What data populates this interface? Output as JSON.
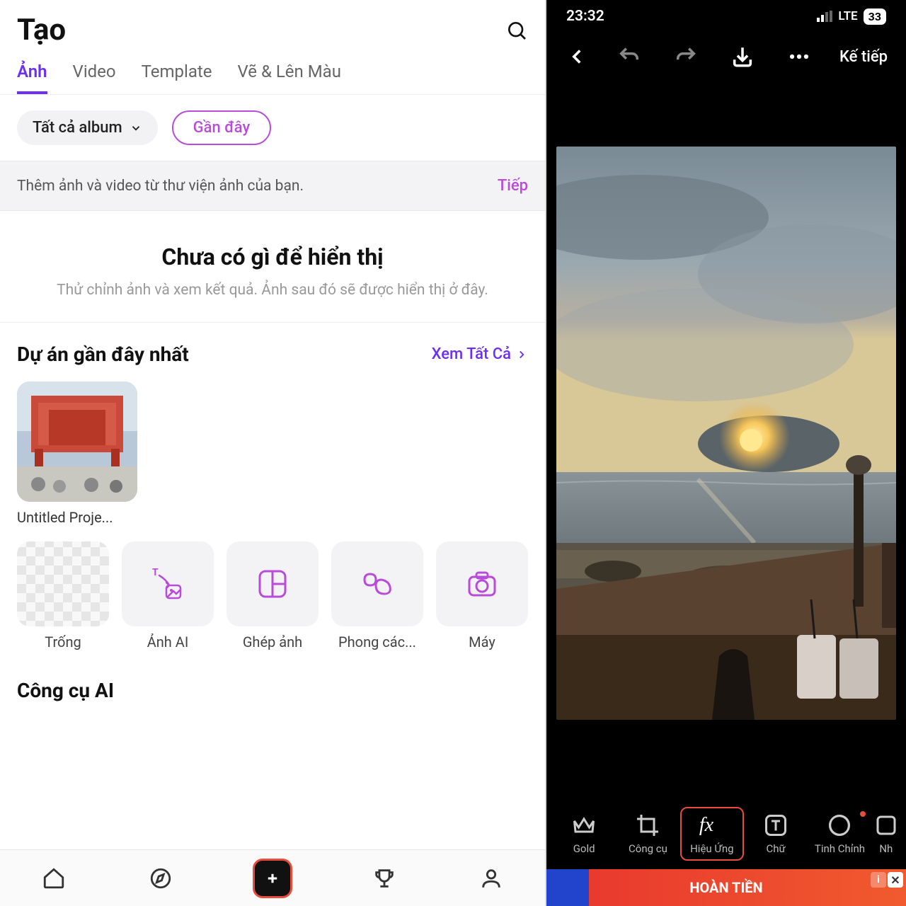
{
  "left": {
    "title": "Tạo",
    "tabs": [
      "Ảnh",
      "Video",
      "Template",
      "Vẽ & Lên Màu"
    ],
    "albumDrop": "Tất cả album",
    "recentChip": "Gần đây",
    "noticeText": "Thêm ảnh và video từ thư viện ảnh của bạn.",
    "noticeAction": "Tiếp",
    "emptyTitle": "Chưa có gì để hiển thị",
    "emptySub": "Thử chỉnh ảnh và xem kết quả. Ảnh sau đó sẽ được hiển thị ở đây.",
    "recentHead": "Dự án gần đây nhất",
    "viewAll": "Xem Tất Cả",
    "project": {
      "name": "Untitled Proje..."
    },
    "tools": [
      {
        "label": "Trống",
        "icon": "blank"
      },
      {
        "label": "Ảnh AI",
        "icon": "ai"
      },
      {
        "label": "Ghép ảnh",
        "icon": "collage"
      },
      {
        "label": "Phong các...",
        "icon": "style"
      },
      {
        "label": "Máy",
        "icon": "camera"
      }
    ],
    "aiHead": "Công cụ AI"
  },
  "right": {
    "time": "23:32",
    "network": "LTE",
    "battery": "33",
    "next": "Kế tiếp",
    "editTools": [
      {
        "label": "Gold",
        "icon": "crown"
      },
      {
        "label": "Công cụ",
        "icon": "crop"
      },
      {
        "label": "Hiệu Ứng",
        "icon": "fx",
        "active": true
      },
      {
        "label": "Chữ",
        "icon": "text"
      },
      {
        "label": "Tinh Chỉnh",
        "icon": "adjust",
        "badge": true
      },
      {
        "label": "Nh",
        "icon": "partial"
      }
    ],
    "adText": "HOÀN TIỀN"
  }
}
